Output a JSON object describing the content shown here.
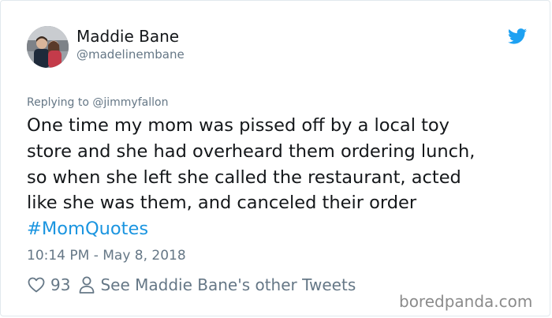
{
  "author": {
    "display_name": "Maddie Bane",
    "handle": "@madelinembane"
  },
  "icons": {
    "brand": "twitter-bird-icon",
    "like": "heart-icon",
    "profile": "person-icon"
  },
  "colors": {
    "brand_blue": "#1da1f2",
    "hashtag_blue": "#1b95e0",
    "secondary_text": "#657786"
  },
  "tweet": {
    "reply_to": "Replying to @jimmyfallon",
    "lines": [
      "One time my mom was pissed off by a local toy",
      "store and she had overheard them ordering lunch,",
      "so when she left she called the restaurant, acted",
      "like she was them, and canceled their order"
    ],
    "hashtag": "#MomQuotes",
    "timestamp": "10:14 PM - May 8, 2018"
  },
  "actions": {
    "like_count": "93",
    "other_tweets_label": "See Maddie Bane's other Tweets"
  },
  "watermark": "boredpanda.com"
}
